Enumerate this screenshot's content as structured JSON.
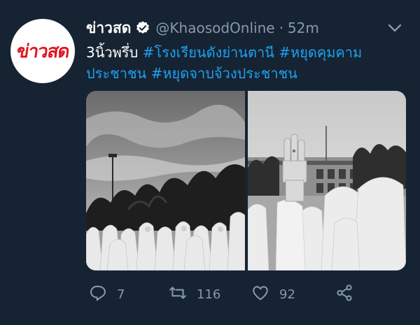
{
  "account": {
    "avatar_text": "ข่าวสด",
    "display_name": "ข่าวสด",
    "handle": "@KhaosodOnline",
    "separator": "·",
    "time": "52m"
  },
  "tweet": {
    "prefix": "3นิ้วพรึ่บ ",
    "hashtag_1": "#โรงเรียนดังย่านตานี",
    "space_1": " ",
    "hashtag_2": "#หยุดคุมคามประชาชน",
    "space_2": " ",
    "hashtag_3": "#หยุดจาบจ้วงประชาชน"
  },
  "media": {
    "photo_1": "students-in-hijabs-assembly",
    "photo_2": "three-finger-salute"
  },
  "actions": {
    "reply_count": "7",
    "retweet_count": "116",
    "like_count": "92"
  },
  "colors": {
    "background": "#162332",
    "link": "#1da1f2",
    "muted": "#8899a6",
    "brand_red": "#e0141e"
  },
  "icons": {
    "verified": "verified-badge-icon",
    "menu": "chevron-down-icon",
    "reply": "reply-icon",
    "retweet": "retweet-icon",
    "like": "heart-icon",
    "share": "share-icon"
  }
}
